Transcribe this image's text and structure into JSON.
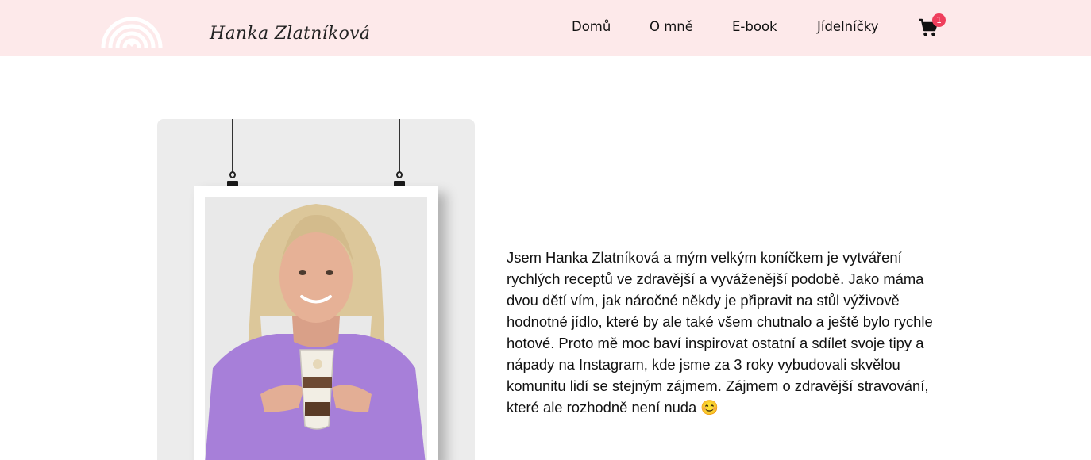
{
  "brand": {
    "name": "Hanka Zlatníková"
  },
  "nav": {
    "items": [
      {
        "label": "Domů"
      },
      {
        "label": "O mně"
      },
      {
        "label": "E-book"
      },
      {
        "label": "Jídelníčky"
      }
    ],
    "cart_count": "1"
  },
  "about": {
    "bio": "Jsem Hanka Zlatníková a mým velkým koníčkem je vytváření rychlých receptů ve zdravější a vyváženější podobě. Jako máma dvou dětí vím, jak náročné někdy je připravit na stůl výživově hodnotné jídlo, které by ale také všem chutnalo a ještě bylo rychle hotové. Proto mě moc baví inspirovat ostatní a sdílet svoje tipy a nápady na Instagram, kde jsme za 3 roky vybudovali skvělou komunitu lidí se stejným zájmem. Zájmem o zdravější stravování, které ale rozhodně není nuda 😊"
  },
  "colors": {
    "header_bg": "#fde9ea",
    "badge": "#ef3e5c"
  },
  "icons": {
    "logo": "rainbow-heart-icon",
    "cart": "shopping-cart-icon"
  }
}
